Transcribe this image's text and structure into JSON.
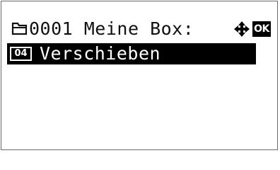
{
  "header": {
    "title": "0001 Meine Box:",
    "folder_icon": "folder-icon",
    "nav_icon": "four-way-arrow-icon",
    "ok_label": "OK"
  },
  "menu": {
    "items": [
      {
        "number": "04",
        "label": "Verschieben",
        "selected": true
      }
    ]
  },
  "colors": {
    "background": "#ffffff",
    "highlight": "#000000",
    "highlight_text": "#ffffff"
  }
}
